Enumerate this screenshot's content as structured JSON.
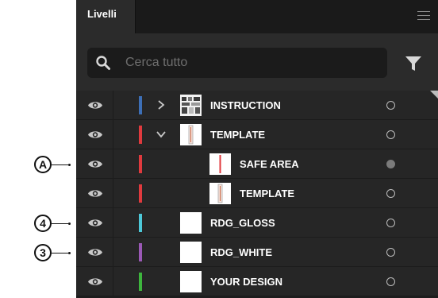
{
  "panel": {
    "tab_label": "Livelli",
    "search_placeholder": "Cerca tutto"
  },
  "layers": [
    {
      "name": "INSTRUCTION",
      "color": "#3d6fb6",
      "chevron": "right",
      "indent": 0,
      "thumb": "instruction",
      "target": "empty"
    },
    {
      "name": "TEMPLATE",
      "color": "#e03a3e",
      "chevron": "down",
      "indent": 0,
      "thumb": "template",
      "target": "empty"
    },
    {
      "name": "SAFE AREA",
      "color": "#e03a3e",
      "chevron": "",
      "indent": 1,
      "thumb": "safe-area",
      "target": "filled"
    },
    {
      "name": "TEMPLATE",
      "color": "#e03a3e",
      "chevron": "",
      "indent": 1,
      "thumb": "template",
      "target": "empty"
    },
    {
      "name": "RDG_GLOSS",
      "color": "#4dc8d8",
      "chevron": "",
      "indent": 0,
      "thumb": "blank",
      "target": "empty"
    },
    {
      "name": "RDG_WHITE",
      "color": "#9b59b6",
      "chevron": "",
      "indent": 0,
      "thumb": "blank",
      "target": "empty"
    },
    {
      "name": "YOUR DESIGN",
      "color": "#3db53d",
      "chevron": "",
      "indent": 0,
      "thumb": "blank",
      "target": "empty"
    }
  ],
  "callouts": [
    {
      "label": "A",
      "row": 2
    },
    {
      "label": "4",
      "row": 4
    },
    {
      "label": "3",
      "row": 5
    }
  ]
}
